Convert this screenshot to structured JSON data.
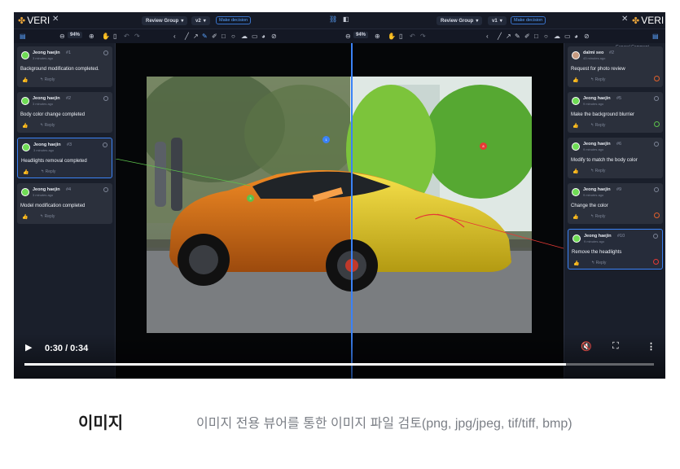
{
  "app": {
    "brand": "VERI",
    "left_pane": {
      "group_label": "Review Group",
      "version_label": "v2",
      "decision_label": "Make decision",
      "zoom": "94%"
    },
    "right_pane": {
      "group_label": "Review Group",
      "version_label": "v1",
      "decision_label": "Make decision",
      "zoom": "94%",
      "general_label": "General Comment"
    }
  },
  "left_comments": [
    {
      "author": "Jeong haejin",
      "num": "#1",
      "time": "3 minutes ago",
      "text": "Background modification completed.",
      "reply": "Reply"
    },
    {
      "author": "Jeong haejin",
      "num": "#2",
      "time": "3 minutes ago",
      "text": "Body color change completed",
      "reply": "Reply"
    },
    {
      "author": "Jeong haejin",
      "num": "#3",
      "time": "3 minutes ago",
      "text": "Headlights removal completed",
      "reply": "Reply"
    },
    {
      "author": "Jeong haejin",
      "num": "#4",
      "time": "3 minutes ago",
      "text": "Model modification completed",
      "reply": "Reply"
    }
  ],
  "right_comments": [
    {
      "author": "dalmi seo",
      "num": "#2",
      "time": "43 minutes ago",
      "text": "Request for photo review",
      "reply": "Reply"
    },
    {
      "author": "Jeong haejin",
      "num": "#5",
      "time": "9 minutes ago",
      "text": "Make the background blurrier",
      "reply": "Reply"
    },
    {
      "author": "Jeong haejin",
      "num": "#6",
      "time": "9 minutes ago",
      "text": "Modify to match the body color",
      "reply": "Reply"
    },
    {
      "author": "Jeong haejin",
      "num": "#9",
      "time": "9 minutes ago",
      "text": "Change the color",
      "reply": "Reply"
    },
    {
      "author": "Jeong haejin",
      "num": "#10",
      "time": "9 minutes ago",
      "text": "Remove the headlights",
      "reply": "Reply"
    }
  ],
  "video": {
    "timecode": "0:30 / 0:34",
    "progress": 0.86
  },
  "caption": {
    "title": "이미지",
    "description": "이미지 전용 뷰어를 통한 이미지 파일 검토(png, jpg/jpeg, tif/tiff, bmp)"
  }
}
